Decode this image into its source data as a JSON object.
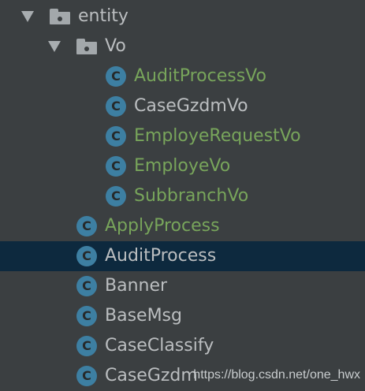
{
  "colors": {
    "background": "#3b3f41",
    "selected_row": "#0d293e",
    "modified_text": "#78a55b",
    "normal_text": "#bbbec0",
    "class_icon": "#3d7fa2"
  },
  "tree": {
    "entity_folder": {
      "label": "entity",
      "icon": "folder-icon",
      "expanded": true
    },
    "vo_folder": {
      "label": "Vo",
      "icon": "folder-icon",
      "expanded": true
    },
    "vo_items": [
      {
        "label": "AuditProcessVo",
        "icon": "class-icon",
        "icon_letter": "C",
        "status": "modified"
      },
      {
        "label": "CaseGzdmVo",
        "icon": "class-icon",
        "icon_letter": "C",
        "status": "normal"
      },
      {
        "label": "EmployeRequestVo",
        "icon": "class-icon",
        "icon_letter": "C",
        "status": "modified"
      },
      {
        "label": "EmployeVo",
        "icon": "class-icon",
        "icon_letter": "C",
        "status": "modified"
      },
      {
        "label": "SubbranchVo",
        "icon": "class-icon",
        "icon_letter": "C",
        "status": "modified"
      }
    ],
    "entity_items": [
      {
        "label": "ApplyProcess",
        "icon": "class-icon",
        "icon_letter": "C",
        "status": "modified",
        "selected": false
      },
      {
        "label": "AuditProcess",
        "icon": "class-icon",
        "icon_letter": "C",
        "status": "normal",
        "selected": true
      },
      {
        "label": "Banner",
        "icon": "class-icon",
        "icon_letter": "C",
        "status": "normal",
        "selected": false
      },
      {
        "label": "BaseMsg",
        "icon": "class-icon",
        "icon_letter": "C",
        "status": "normal",
        "selected": false
      },
      {
        "label": "CaseClassify",
        "icon": "class-icon",
        "icon_letter": "C",
        "status": "normal",
        "selected": false
      },
      {
        "label": "CaseGzdm",
        "icon": "class-icon",
        "icon_letter": "C",
        "status": "normal",
        "selected": false
      }
    ]
  },
  "watermark": "https://blog.csdn.net/one_hwx"
}
